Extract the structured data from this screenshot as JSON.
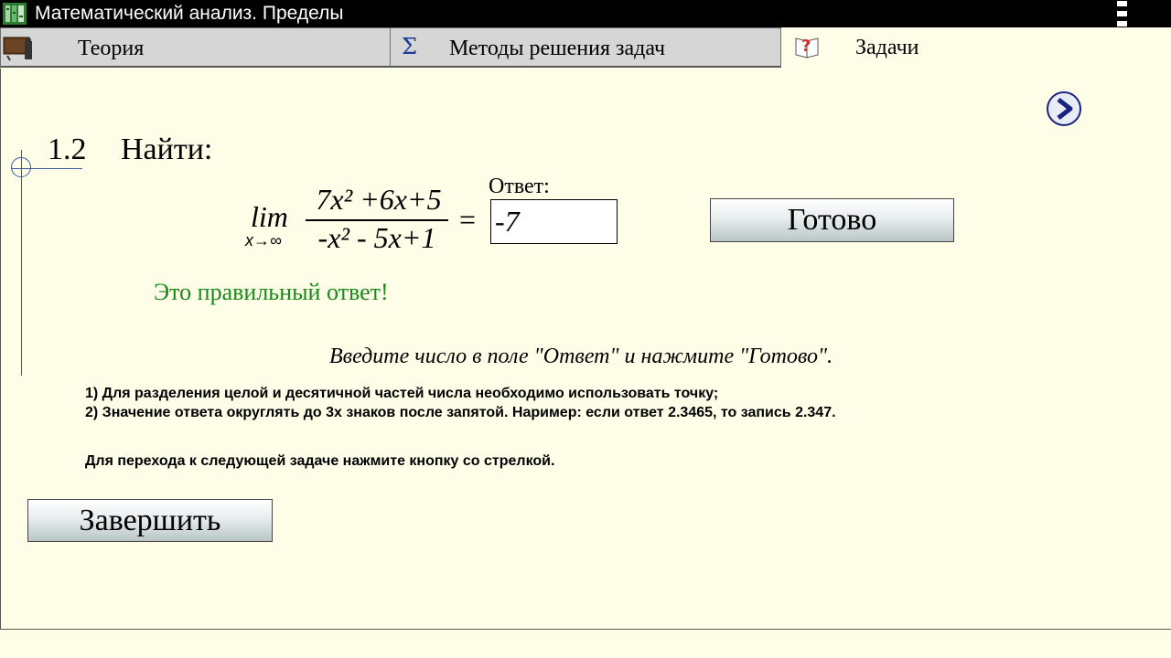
{
  "window": {
    "title": "Математический анализ. Пределы"
  },
  "tabs": [
    {
      "label": "Теория",
      "icon": "teacher-board-icon",
      "active": false
    },
    {
      "label": "Методы решения задач",
      "icon": "sigma-icon",
      "active": false
    },
    {
      "label": "Задачи",
      "icon": "question-book-icon",
      "active": true
    }
  ],
  "problem": {
    "number": "1.2",
    "title": "Найти:",
    "lim": "lim",
    "lim_sub": "x→∞",
    "numerator": "7x² +6x+5",
    "denominator": "-x² - 5x+1",
    "equals": "="
  },
  "answer": {
    "label": "Ответ:",
    "value": "-7"
  },
  "buttons": {
    "ready": "Готово",
    "finish": "Завершить"
  },
  "feedback": "Это правильный ответ!",
  "instruction": "Введите число в поле \"Ответ\" и нажмите \"Готово\".",
  "notes": [
    "1) Для разделения целой и десятичной частей числа необходимо использовать точку;",
    "2) Значение ответа округлять до 3х знаков после запятой. Наример: если ответ 2.3465, то запись 2.347.",
    "Для перехода к следующей задаче нажмите кнопку со стрелкой."
  ],
  "colors": {
    "background": "#fdfde8",
    "feedback": "#1a8a1a",
    "next_button": "#1a237e"
  }
}
